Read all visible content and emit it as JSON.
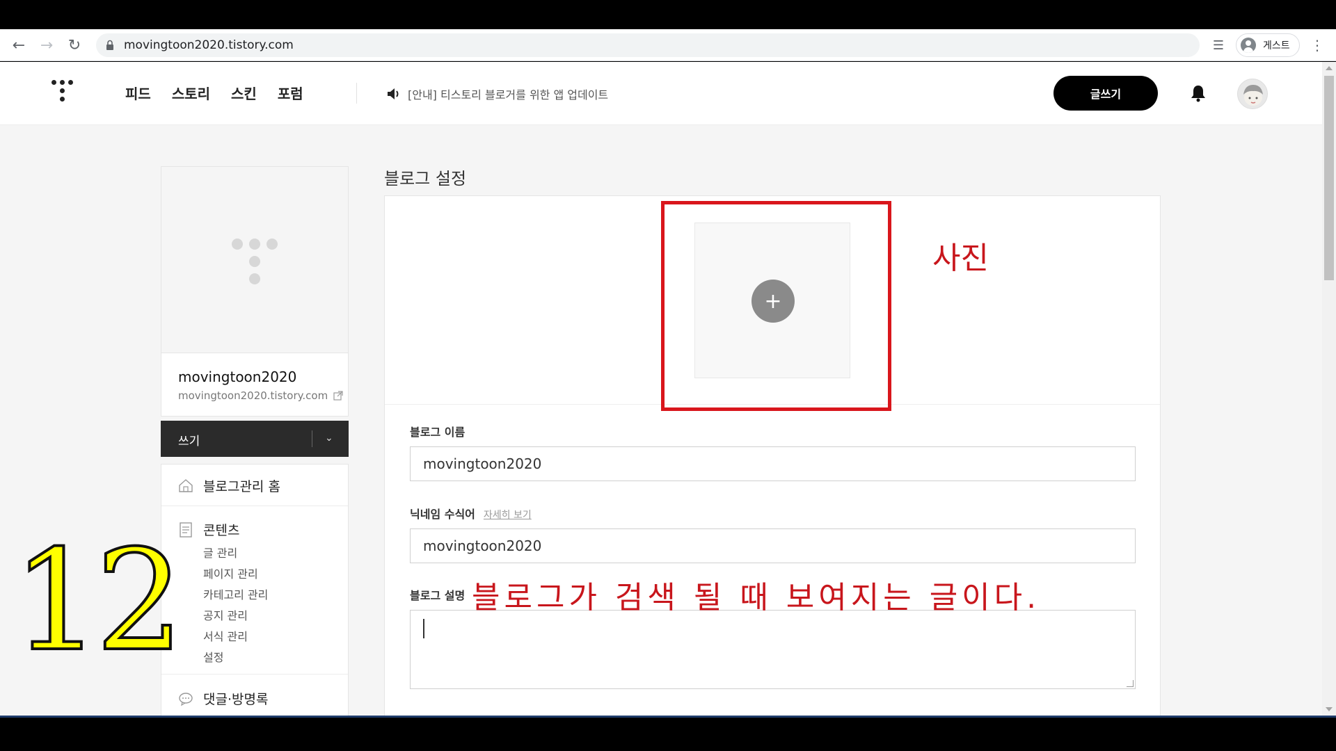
{
  "browser": {
    "url": "movingtoon2020.tistory.com",
    "profile_label": "게스트"
  },
  "header": {
    "nav": [
      "피드",
      "스토리",
      "스킨",
      "포럼"
    ],
    "notice": "[안내] 티스토리 블로거를 위한 앱 업데이트",
    "write_button": "글쓰기"
  },
  "sidebar": {
    "blog_name": "movingtoon2020",
    "blog_url": "movingtoon2020.tistory.com",
    "write_label": "쓰기",
    "home_label": "블로그관리 홈",
    "contents_title": "콘텐츠",
    "contents_items": [
      "글 관리",
      "페이지 관리",
      "카테고리 관리",
      "공지 관리",
      "서식 관리",
      "설정"
    ],
    "comments_title": "댓글·방명록"
  },
  "main": {
    "page_title": "블로그 설정",
    "photo_add_symbol": "+",
    "blog_name_label": "블로그 이름",
    "blog_name_value": "movingtoon2020",
    "nickname_label": "닉네임 수식어",
    "nickname_link": "자세히 보기",
    "nickname_value": "movingtoon2020",
    "description_label": "블로그 설명",
    "description_value": ""
  },
  "annotations": {
    "photo": "사진",
    "description": "블로그가 검색 될 때 보여지는 글이다.",
    "step_number": "12",
    "highlight_color": "#d9161c",
    "step_color": "#ffff00"
  },
  "colors": {
    "accent": "#000000",
    "page_bg": "#f5f5f5"
  }
}
